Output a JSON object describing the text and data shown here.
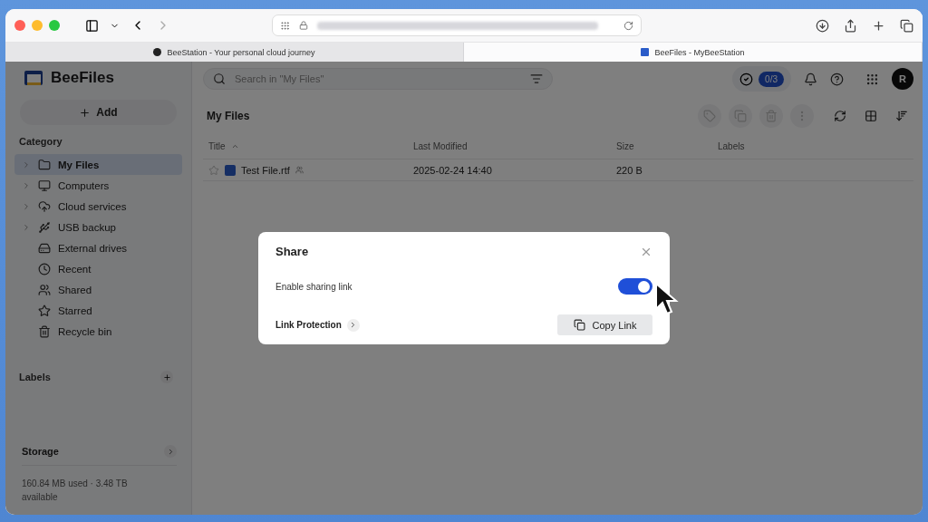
{
  "browser": {
    "tabs": [
      {
        "title": "BeeStation - Your personal cloud journey",
        "selected": false
      },
      {
        "title": "BeeFiles - MyBeeStation",
        "selected": true
      }
    ]
  },
  "app": {
    "name": "BeeFiles",
    "add_button": "Add",
    "category_heading": "Category",
    "sidebar_items": [
      {
        "kind": "folder",
        "label": "My Files",
        "expandable": true,
        "selected": true
      },
      {
        "kind": "computer",
        "label": "Computers",
        "expandable": true,
        "selected": false
      },
      {
        "kind": "cloud",
        "label": "Cloud services",
        "expandable": true,
        "selected": false
      },
      {
        "kind": "usb",
        "label": "USB backup",
        "expandable": true,
        "selected": false
      },
      {
        "kind": "drive",
        "label": "External drives",
        "expandable": false,
        "selected": false
      },
      {
        "kind": "recent",
        "label": "Recent",
        "expandable": false,
        "selected": false
      },
      {
        "kind": "shared",
        "label": "Shared",
        "expandable": false,
        "selected": false
      },
      {
        "kind": "star",
        "label": "Starred",
        "expandable": false,
        "selected": false
      },
      {
        "kind": "trash",
        "label": "Recycle bin",
        "expandable": false,
        "selected": false
      }
    ],
    "labels_heading": "Labels",
    "storage": {
      "heading": "Storage",
      "usage": "160.84 MB used  ·  3.48 TB available"
    },
    "search": {
      "placeholder": "Search in \"My Files\""
    },
    "tasks_badge": "0/3",
    "avatar": "R",
    "folder_title": "My Files",
    "toolbar": [
      {
        "kind": "tag",
        "disabled": true
      },
      {
        "kind": "copy",
        "disabled": true
      },
      {
        "kind": "trash",
        "disabled": true
      },
      {
        "kind": "more",
        "disabled": true
      },
      {
        "kind": "refresh",
        "disabled": false
      },
      {
        "kind": "grid",
        "disabled": false
      },
      {
        "kind": "sort",
        "disabled": false
      }
    ],
    "table": {
      "columns": [
        "Title",
        "Last Modified",
        "Size",
        "Labels"
      ],
      "rows": [
        {
          "starred": false,
          "name": "Test File.rtf",
          "shared": true,
          "modified": "2025-02-24 14:40",
          "size": "220 B"
        }
      ]
    }
  },
  "dialog": {
    "title": "Share",
    "toggle_label": "Enable sharing link",
    "on": true,
    "protection_label": "Link Protection",
    "copy_button": "Copy Link"
  }
}
